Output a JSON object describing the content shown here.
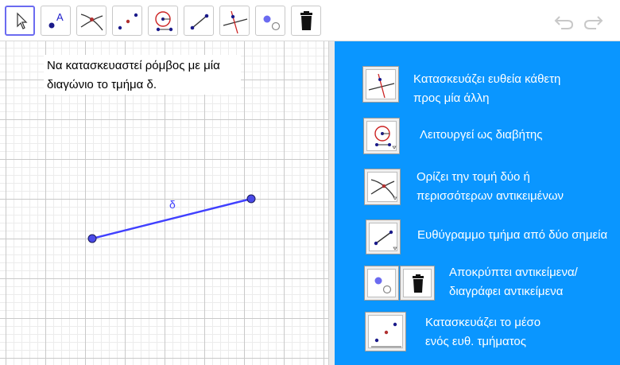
{
  "toolbar": {
    "tools": [
      {
        "name": "move-tool",
        "selected": true
      },
      {
        "name": "point-tool",
        "label": "A"
      },
      {
        "name": "intersect-tool"
      },
      {
        "name": "midpoint-tool"
      },
      {
        "name": "compass-tool"
      },
      {
        "name": "segment-tool"
      },
      {
        "name": "perpendicular-line-tool"
      },
      {
        "name": "show-hide-object-tool"
      },
      {
        "name": "delete-tool"
      }
    ],
    "undo_icon": "undo-icon",
    "redo_icon": "redo-icon"
  },
  "graphics": {
    "task_line1": "Να κατασκευαστεί ρόμβος με μία",
    "task_line2": "διαγώνιο το τμήμα δ.",
    "segment_label": "δ",
    "segment_color": "#4040ff",
    "point_color": "#4a4ae8"
  },
  "panel": {
    "background": "#0a96ff",
    "items": [
      {
        "icon": "perpendicular-line-icon",
        "line1": "Κατασκευάζει ευθεία κάθετη",
        "line2": "προς μία άλλη"
      },
      {
        "icon": "compass-icon",
        "line1": "Λειτουργεί ως διαβήτης"
      },
      {
        "icon": "intersect-icon",
        "line1": "Ορίζει την τομή δύο ή",
        "line2": "περισσότερων αντικειμένων"
      },
      {
        "icon": "segment-icon",
        "line1": "Ευθύγραμμο τμήμα από δύο σημεία"
      },
      {
        "icon": "show-hide-and-delete-icons",
        "line1": "Αποκρύπτει αντικείμενα/",
        "line2": "διαγράφει αντικείμενα"
      },
      {
        "icon": "midpoint-icon",
        "line1": "Κατασκευάζει το μέσο",
        "line2": "ενός ευθ. τμήματος"
      }
    ]
  }
}
